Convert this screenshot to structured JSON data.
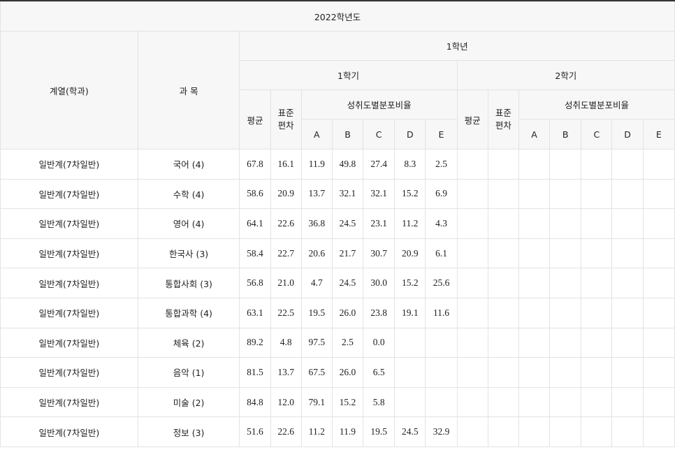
{
  "header": {
    "year": "2022학년도",
    "grade": "1학년",
    "col_dept": "계열(학과)",
    "col_subject": "과 목",
    "semesters": [
      "1학기",
      "2학기"
    ],
    "col_avg": "평균",
    "col_std": "표준\n편차",
    "col_dist": "성취도별분포비율",
    "grades": [
      "A",
      "B",
      "C",
      "D",
      "E"
    ]
  },
  "rows": [
    {
      "dept": "일반계(7차일반)",
      "subject": "국어 (4)",
      "avg": "67.8",
      "std": "16.1",
      "a": "11.9",
      "b": "49.8",
      "c": "27.4",
      "d": "8.3",
      "e": "2.5"
    },
    {
      "dept": "일반계(7차일반)",
      "subject": "수학 (4)",
      "avg": "58.6",
      "std": "20.9",
      "a": "13.7",
      "b": "32.1",
      "c": "32.1",
      "d": "15.2",
      "e": "6.9"
    },
    {
      "dept": "일반계(7차일반)",
      "subject": "영어 (4)",
      "avg": "64.1",
      "std": "22.6",
      "a": "36.8",
      "b": "24.5",
      "c": "23.1",
      "d": "11.2",
      "e": "4.3"
    },
    {
      "dept": "일반계(7차일반)",
      "subject": "한국사 (3)",
      "avg": "58.4",
      "std": "22.7",
      "a": "20.6",
      "b": "21.7",
      "c": "30.7",
      "d": "20.9",
      "e": "6.1"
    },
    {
      "dept": "일반계(7차일반)",
      "subject": "통합사회 (3)",
      "avg": "56.8",
      "std": "21.0",
      "a": "4.7",
      "b": "24.5",
      "c": "30.0",
      "d": "15.2",
      "e": "25.6"
    },
    {
      "dept": "일반계(7차일반)",
      "subject": "통합과학 (4)",
      "avg": "63.1",
      "std": "22.5",
      "a": "19.5",
      "b": "26.0",
      "c": "23.8",
      "d": "19.1",
      "e": "11.6"
    },
    {
      "dept": "일반계(7차일반)",
      "subject": "체육 (2)",
      "avg": "89.2",
      "std": "4.8",
      "a": "97.5",
      "b": "2.5",
      "c": "0.0",
      "d": "",
      "e": ""
    },
    {
      "dept": "일반계(7차일반)",
      "subject": "음악 (1)",
      "avg": "81.5",
      "std": "13.7",
      "a": "67.5",
      "b": "26.0",
      "c": "6.5",
      "d": "",
      "e": ""
    },
    {
      "dept": "일반계(7차일반)",
      "subject": "미술 (2)",
      "avg": "84.8",
      "std": "12.0",
      "a": "79.1",
      "b": "15.2",
      "c": "5.8",
      "d": "",
      "e": ""
    },
    {
      "dept": "일반계(7차일반)",
      "subject": "정보 (3)",
      "avg": "51.6",
      "std": "22.6",
      "a": "11.2",
      "b": "11.9",
      "c": "19.5",
      "d": "24.5",
      "e": "32.9"
    }
  ]
}
